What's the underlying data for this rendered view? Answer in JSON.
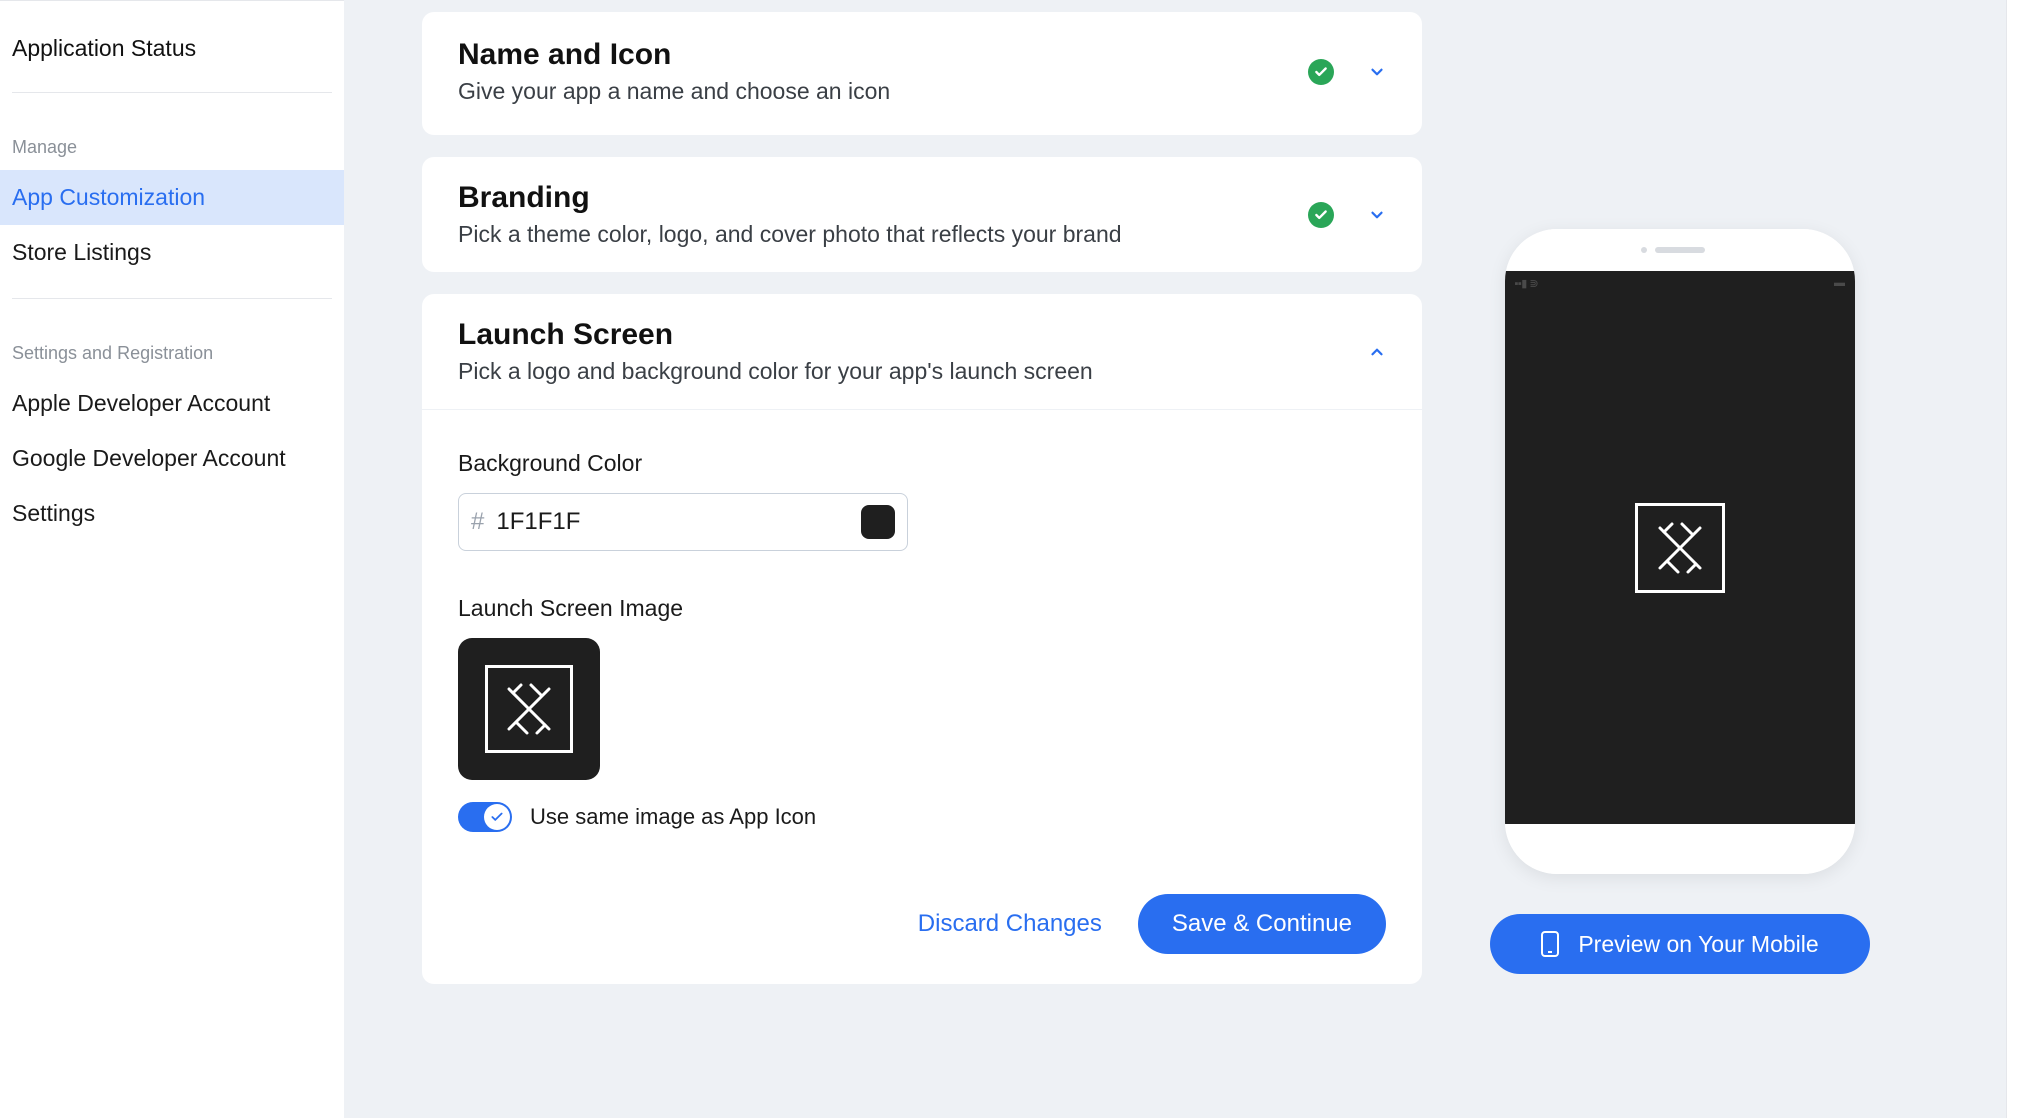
{
  "sidebar": {
    "application_status": "Application Status",
    "manage_heading": "Manage",
    "items_manage": [
      {
        "label": "App Customization",
        "active": true
      },
      {
        "label": "Store Listings",
        "active": false
      }
    ],
    "settings_heading": "Settings and Registration",
    "items_settings": [
      {
        "label": "Apple Developer Account"
      },
      {
        "label": "Google Developer Account"
      },
      {
        "label": "Settings"
      }
    ]
  },
  "cards": {
    "name_icon": {
      "title": "Name and Icon",
      "subtitle": "Give your app a name and choose an icon"
    },
    "branding": {
      "title": "Branding",
      "subtitle": "Pick a theme color, logo, and cover photo that reflects your brand"
    },
    "launch": {
      "title": "Launch Screen",
      "subtitle": "Pick a logo and background color for your app's launch screen",
      "bg_label": "Background Color",
      "bg_value": "1F1F1F",
      "image_label": "Launch Screen Image",
      "toggle_label": "Use same image as App Icon",
      "discard": "Discard Changes",
      "save": "Save & Continue"
    }
  },
  "preview": {
    "button": "Preview on Your Mobile"
  },
  "colors": {
    "accent": "#296ef0",
    "success": "#2aa658",
    "launch_bg": "#1f1f1f"
  }
}
